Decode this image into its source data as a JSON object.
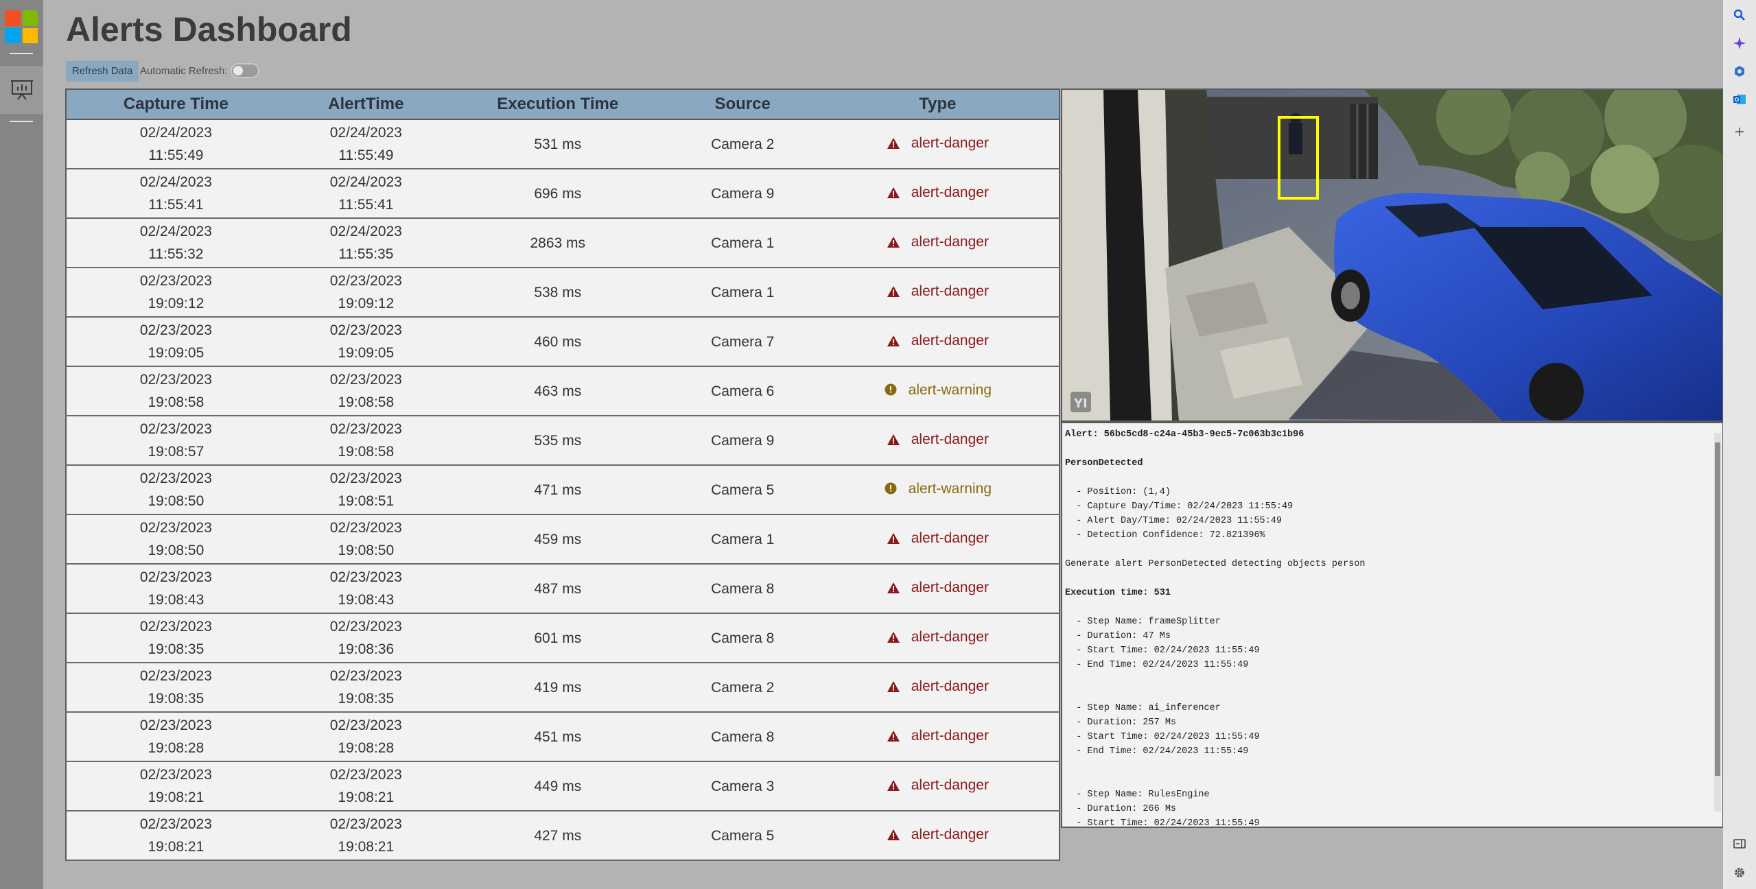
{
  "page": {
    "title": "Alerts Dashboard"
  },
  "controls": {
    "refresh_label": "Refresh Data",
    "auto_refresh_label": "Automatic Refresh:",
    "auto_refresh_on": false
  },
  "table": {
    "headers": {
      "capture": "Capture Time",
      "alert": "AlertTime",
      "exec": "Execution Time",
      "source": "Source",
      "type": "Type"
    },
    "rows": [
      {
        "cap_date": "02/24/2023",
        "cap_time": "11:55:49",
        "alert_date": "02/24/2023",
        "alert_time": "11:55:49",
        "exec": "531 ms",
        "source": "Camera 2",
        "type": "alert-danger"
      },
      {
        "cap_date": "02/24/2023",
        "cap_time": "11:55:41",
        "alert_date": "02/24/2023",
        "alert_time": "11:55:41",
        "exec": "696 ms",
        "source": "Camera 9",
        "type": "alert-danger"
      },
      {
        "cap_date": "02/24/2023",
        "cap_time": "11:55:32",
        "alert_date": "02/24/2023",
        "alert_time": "11:55:35",
        "exec": "2863 ms",
        "source": "Camera 1",
        "type": "alert-danger"
      },
      {
        "cap_date": "02/23/2023",
        "cap_time": "19:09:12",
        "alert_date": "02/23/2023",
        "alert_time": "19:09:12",
        "exec": "538 ms",
        "source": "Camera 1",
        "type": "alert-danger"
      },
      {
        "cap_date": "02/23/2023",
        "cap_time": "19:09:05",
        "alert_date": "02/23/2023",
        "alert_time": "19:09:05",
        "exec": "460 ms",
        "source": "Camera 7",
        "type": "alert-danger"
      },
      {
        "cap_date": "02/23/2023",
        "cap_time": "19:08:58",
        "alert_date": "02/23/2023",
        "alert_time": "19:08:58",
        "exec": "463 ms",
        "source": "Camera 6",
        "type": "alert-warning"
      },
      {
        "cap_date": "02/23/2023",
        "cap_time": "19:08:57",
        "alert_date": "02/23/2023",
        "alert_time": "19:08:58",
        "exec": "535 ms",
        "source": "Camera 9",
        "type": "alert-danger"
      },
      {
        "cap_date": "02/23/2023",
        "cap_time": "19:08:50",
        "alert_date": "02/23/2023",
        "alert_time": "19:08:51",
        "exec": "471 ms",
        "source": "Camera 5",
        "type": "alert-warning"
      },
      {
        "cap_date": "02/23/2023",
        "cap_time": "19:08:50",
        "alert_date": "02/23/2023",
        "alert_time": "19:08:50",
        "exec": "459 ms",
        "source": "Camera 1",
        "type": "alert-danger"
      },
      {
        "cap_date": "02/23/2023",
        "cap_time": "19:08:43",
        "alert_date": "02/23/2023",
        "alert_time": "19:08:43",
        "exec": "487 ms",
        "source": "Camera 8",
        "type": "alert-danger"
      },
      {
        "cap_date": "02/23/2023",
        "cap_time": "19:08:35",
        "alert_date": "02/23/2023",
        "alert_time": "19:08:36",
        "exec": "601 ms",
        "source": "Camera 8",
        "type": "alert-danger"
      },
      {
        "cap_date": "02/23/2023",
        "cap_time": "19:08:35",
        "alert_date": "02/23/2023",
        "alert_time": "19:08:35",
        "exec": "419 ms",
        "source": "Camera 2",
        "type": "alert-danger"
      },
      {
        "cap_date": "02/23/2023",
        "cap_time": "19:08:28",
        "alert_date": "02/23/2023",
        "alert_time": "19:08:28",
        "exec": "451 ms",
        "source": "Camera 8",
        "type": "alert-danger"
      },
      {
        "cap_date": "02/23/2023",
        "cap_time": "19:08:21",
        "alert_date": "02/23/2023",
        "alert_time": "19:08:21",
        "exec": "449 ms",
        "source": "Camera 3",
        "type": "alert-danger"
      },
      {
        "cap_date": "02/23/2023",
        "cap_time": "19:08:21",
        "alert_date": "02/23/2023",
        "alert_time": "19:08:21",
        "exec": "427 ms",
        "source": "Camera 5",
        "type": "alert-danger"
      }
    ]
  },
  "camera": {
    "watermark": "YI"
  },
  "details": {
    "alert_line": "Alert: 56bc5cd8-c24a-45b3-9ec5-7c063b3c1b96",
    "event": "PersonDetected",
    "position": "  - Position: (1,4)",
    "capture": "  - Capture Day/Time: 02/24/2023 11:55:49",
    "alert_time": "  - Alert Day/Time: 02/24/2023 11:55:49",
    "confidence": "  - Detection Confidence: 72.821396%",
    "generate": "Generate alert PersonDetected detecting objects person",
    "exec_time": "Execution time: 531",
    "steps": [
      {
        "name": "  - Step Name: frameSplitter",
        "duration": "  - Duration: 47 Ms",
        "start": "  - Start Time: 02/24/2023 11:55:49",
        "end": "  - End Time: 02/24/2023 11:55:49"
      },
      {
        "name": "  - Step Name: ai_inferencer",
        "duration": "  - Duration: 257 Ms",
        "start": "  - Start Time: 02/24/2023 11:55:49",
        "end": "  - End Time: 02/24/2023 11:55:49"
      },
      {
        "name": "  - Step Name: RulesEngine",
        "duration": "  - Duration: 266 Ms",
        "start": "  - Start Time: 02/24/2023 11:55:49"
      }
    ]
  },
  "icons": {
    "left": [
      "microsoft-logo-icon",
      "presentation-icon"
    ],
    "right": [
      "search-icon",
      "sparkle-icon",
      "app-icon",
      "outlook-icon",
      "plus-icon",
      "sidebar-icon",
      "gear-icon"
    ]
  },
  "colors": {
    "header_bg": "#8aa9c1",
    "danger": "#8a1a1a",
    "warning": "#8a6a10",
    "highlight_box": "#ffff00"
  }
}
